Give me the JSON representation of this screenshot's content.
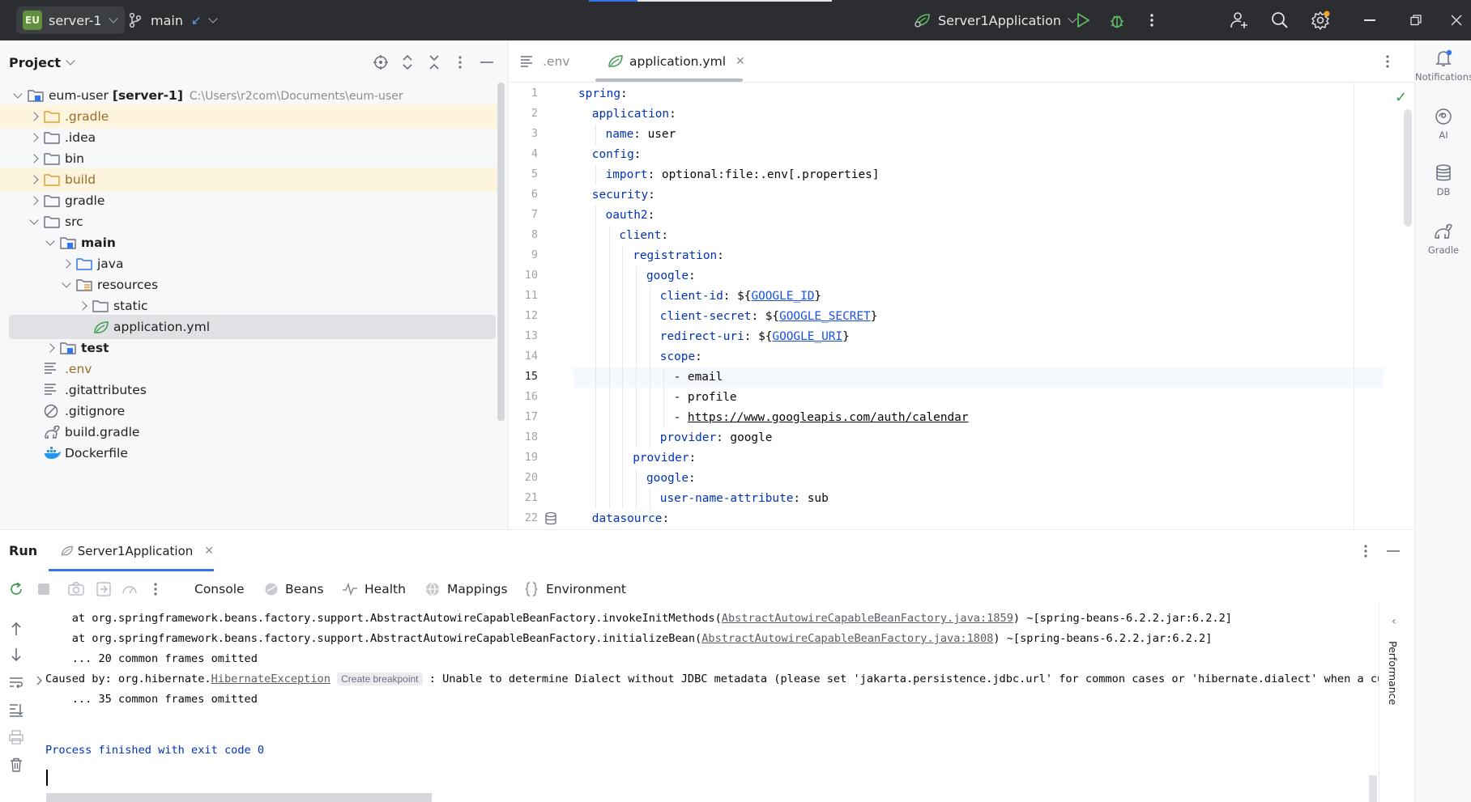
{
  "topbar": {
    "project_badge": "EU",
    "project_name": "server-1",
    "branch_name": "main",
    "run_config": "Server1Application"
  },
  "project_panel": {
    "title": "Project",
    "tree": [
      {
        "label": "eum-user",
        "suffix": "[server-1]",
        "path": "C:\\Users\\r2com\\Documents\\eum-user",
        "depth": 0,
        "chevron": "down",
        "icon": "module-folder"
      },
      {
        "label": ".gradle",
        "depth": 1,
        "chevron": "right",
        "icon": "folder-orange",
        "muted": true,
        "highlight": true
      },
      {
        "label": ".idea",
        "depth": 1,
        "chevron": "right",
        "icon": "folder"
      },
      {
        "label": "bin",
        "depth": 1,
        "chevron": "right",
        "icon": "folder"
      },
      {
        "label": "build",
        "depth": 1,
        "chevron": "right",
        "icon": "folder-orange",
        "muted": true,
        "highlight": true
      },
      {
        "label": "gradle",
        "depth": 1,
        "chevron": "right",
        "icon": "folder"
      },
      {
        "label": "src",
        "depth": 1,
        "chevron": "down",
        "icon": "folder"
      },
      {
        "label": "main",
        "depth": 2,
        "chevron": "down",
        "icon": "module-folder",
        "bold": true
      },
      {
        "label": "java",
        "depth": 3,
        "chevron": "right",
        "icon": "folder-blue"
      },
      {
        "label": "resources",
        "depth": 3,
        "chevron": "down",
        "icon": "resources-folder"
      },
      {
        "label": "static",
        "depth": 4,
        "chevron": "right",
        "icon": "folder"
      },
      {
        "label": "application.yml",
        "depth": 4,
        "chevron": "none",
        "icon": "spring-leaf",
        "selected": true
      },
      {
        "label": "test",
        "depth": 2,
        "chevron": "right",
        "icon": "module-folder",
        "bold": true
      },
      {
        "label": ".env",
        "depth": 1,
        "chevron": "none",
        "icon": "text-file",
        "muted": true
      },
      {
        "label": ".gitattributes",
        "depth": 1,
        "chevron": "none",
        "icon": "text-file"
      },
      {
        "label": ".gitignore",
        "depth": 1,
        "chevron": "none",
        "icon": "ignore-file"
      },
      {
        "label": "build.gradle",
        "depth": 1,
        "chevron": "none",
        "icon": "gradle-elephant"
      },
      {
        "label": "Dockerfile",
        "depth": 1,
        "chevron": "none",
        "icon": "docker-whale"
      }
    ]
  },
  "editor": {
    "tabs": [
      {
        "label": ".env",
        "icon": "text-file",
        "active": false
      },
      {
        "label": "application.yml",
        "icon": "spring-leaf",
        "active": true,
        "closable": true
      }
    ],
    "current_line": 15,
    "lines": [
      {
        "n": "1",
        "indent": 0,
        "parts": [
          [
            "k",
            "spring"
          ],
          [
            "t",
            ":"
          ]
        ]
      },
      {
        "n": "2",
        "indent": 1,
        "parts": [
          [
            "k",
            "application"
          ],
          [
            "t",
            ":"
          ]
        ]
      },
      {
        "n": "3",
        "indent": 2,
        "parts": [
          [
            "k",
            "name"
          ],
          [
            "t",
            ": user"
          ]
        ]
      },
      {
        "n": "4",
        "indent": 1,
        "parts": [
          [
            "k",
            "config"
          ],
          [
            "t",
            ":"
          ]
        ]
      },
      {
        "n": "5",
        "indent": 2,
        "parts": [
          [
            "k",
            "import"
          ],
          [
            "t",
            ": optional:file:.env[.properties]"
          ]
        ]
      },
      {
        "n": "6",
        "indent": 1,
        "parts": [
          [
            "k",
            "security"
          ],
          [
            "t",
            ":"
          ]
        ]
      },
      {
        "n": "7",
        "indent": 2,
        "parts": [
          [
            "k",
            "oauth2"
          ],
          [
            "t",
            ":"
          ]
        ]
      },
      {
        "n": "8",
        "indent": 3,
        "parts": [
          [
            "k",
            "client"
          ],
          [
            "t",
            ":"
          ]
        ]
      },
      {
        "n": "9",
        "indent": 4,
        "parts": [
          [
            "k",
            "registration"
          ],
          [
            "t",
            ":"
          ]
        ]
      },
      {
        "n": "10",
        "indent": 5,
        "parts": [
          [
            "k",
            "google"
          ],
          [
            "t",
            ":"
          ]
        ]
      },
      {
        "n": "11",
        "indent": 6,
        "parts": [
          [
            "k",
            "client-id"
          ],
          [
            "t",
            ": ${"
          ],
          [
            "v",
            "GOOGLE_ID"
          ],
          [
            "t",
            "}"
          ]
        ]
      },
      {
        "n": "12",
        "indent": 6,
        "parts": [
          [
            "k",
            "client-secret"
          ],
          [
            "t",
            ": ${"
          ],
          [
            "v",
            "GOOGLE_SECRET"
          ],
          [
            "t",
            "}"
          ]
        ]
      },
      {
        "n": "13",
        "indent": 6,
        "parts": [
          [
            "k",
            "redirect-uri"
          ],
          [
            "t",
            ": ${"
          ],
          [
            "v",
            "GOOGLE_URI"
          ],
          [
            "t",
            "}"
          ]
        ]
      },
      {
        "n": "14",
        "indent": 6,
        "parts": [
          [
            "k",
            "scope"
          ],
          [
            "t",
            ":"
          ]
        ]
      },
      {
        "n": "15",
        "indent": 7,
        "parts": [
          [
            "t",
            "- email"
          ]
        ]
      },
      {
        "n": "16",
        "indent": 7,
        "parts": [
          [
            "t",
            "- profile"
          ]
        ]
      },
      {
        "n": "17",
        "indent": 7,
        "parts": [
          [
            "t",
            "- "
          ],
          [
            "u",
            "https://www.googleapis.com/auth/calendar"
          ]
        ]
      },
      {
        "n": "18",
        "indent": 6,
        "parts": [
          [
            "k",
            "provider"
          ],
          [
            "t",
            ": google"
          ]
        ]
      },
      {
        "n": "19",
        "indent": 4,
        "parts": [
          [
            "k",
            "provider"
          ],
          [
            "t",
            ":"
          ]
        ]
      },
      {
        "n": "20",
        "indent": 5,
        "parts": [
          [
            "k",
            "google"
          ],
          [
            "t",
            ":"
          ]
        ]
      },
      {
        "n": "21",
        "indent": 6,
        "parts": [
          [
            "k",
            "user-name-attribute"
          ],
          [
            "t",
            ": sub"
          ]
        ]
      },
      {
        "n": "22",
        "indent": 1,
        "parts": [
          [
            "k",
            "datasource"
          ],
          [
            "t",
            ":"
          ]
        ]
      }
    ]
  },
  "right_strip": {
    "items": [
      {
        "label": "Notifications",
        "icon": "bell-icon"
      },
      {
        "label": "AI",
        "icon": "ai-icon"
      },
      {
        "label": "DB",
        "icon": "database-icon"
      },
      {
        "label": "Gradle",
        "icon": "gradle-icon"
      }
    ]
  },
  "run_panel": {
    "title": "Run",
    "tab_label": "Server1Application",
    "console_tabs": [
      {
        "label": "Console",
        "icon": "none",
        "active": true
      },
      {
        "label": "Beans",
        "icon": "beans-icon"
      },
      {
        "label": "Health",
        "icon": "health-icon"
      },
      {
        "label": "Mappings",
        "icon": "mappings-icon"
      },
      {
        "label": "Environment",
        "icon": "environment-icon"
      }
    ],
    "console_lines": [
      {
        "pre": "    at org.springframework.beans.factory.support.AbstractAutowireCapableBeanFactory.invokeInitMethods(",
        "link": "AbstractAutowireCapableBeanFactory.java:1859",
        "post": ") ~[spring-beans-6.2.2.jar:6.2.2]"
      },
      {
        "pre": "    at org.springframework.beans.factory.support.AbstractAutowireCapableBeanFactory.initializeBean(",
        "link": "AbstractAutowireCapableBeanFactory.java:1808",
        "post": ") ~[spring-beans-6.2.2.jar:6.2.2]"
      },
      {
        "pre": "    ... 20 common frames omitted",
        "link": "",
        "post": ""
      },
      {
        "pre": "Caused by: org.hibernate.",
        "link": "HibernateException",
        "hint": "Create breakpoint",
        "post": " : Unable to determine Dialect without JDBC metadata (please set 'jakarta.persistence.jdbc.url' for common cases or 'hibernate.dialect' when a custom"
      },
      {
        "pre": "    ... 35 common frames omitted",
        "link": "",
        "post": ""
      }
    ],
    "exit_message": "Process finished with exit code 0",
    "side_label": "Performance"
  },
  "colors": {
    "topbar_bg": "#2b2d30",
    "accent": "#3574f0",
    "keyword": "#0033b3",
    "highlight_row": "#fdf4dd",
    "run_green": "#3a9b4c"
  }
}
